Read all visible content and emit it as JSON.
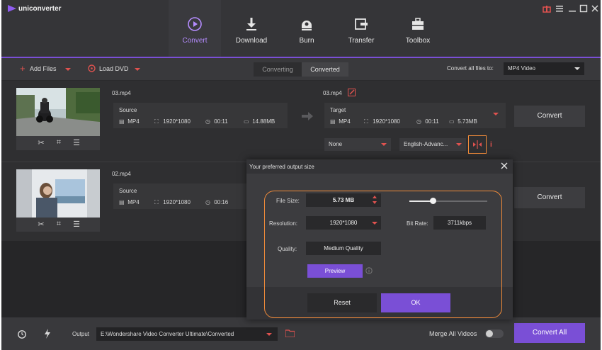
{
  "app": {
    "name": "uniconverter"
  },
  "nav": {
    "tabs": [
      {
        "label": "Convert",
        "icon": "convert-icon",
        "active": true
      },
      {
        "label": "Download",
        "icon": "download-icon"
      },
      {
        "label": "Burn",
        "icon": "burn-icon"
      },
      {
        "label": "Transfer",
        "icon": "transfer-icon"
      },
      {
        "label": "Toolbox",
        "icon": "toolbox-icon"
      }
    ]
  },
  "toolbar": {
    "add_files": "Add Files",
    "load_dvd": "Load DVD",
    "seg_converting": "Converting",
    "seg_converted": "Converted",
    "convert_all_label": "Convert all files to:",
    "convert_all_value": "MP4 Video"
  },
  "files": [
    {
      "name": "03.mp4",
      "source": {
        "title": "Source",
        "format": "MP4",
        "resolution": "1920*1080",
        "duration": "00:11",
        "size": "14.88MB"
      },
      "target": {
        "name": "03.mp4",
        "title": "Target",
        "format": "MP4",
        "resolution": "1920*1080",
        "duration": "00:11",
        "size": "5.73MB"
      },
      "subtitle": "None",
      "audio": "English-Advanc...",
      "convert": "Convert"
    },
    {
      "name": "02.mp4",
      "source": {
        "title": "Source",
        "format": "MP4",
        "resolution": "1920*1080",
        "duration": "00:16"
      },
      "convert": "Convert"
    }
  ],
  "dialog": {
    "title": "Your preferred output size",
    "file_size_label": "File Size:",
    "file_size_value": "5.73  MB",
    "slider_position": 0.3,
    "resolution_label": "Resolution:",
    "resolution_value": "1920*1080",
    "bitrate_label": "Bit Rate:",
    "bitrate_value": "3711kbps",
    "quality_label": "Quality:",
    "quality_value": "Medium Quality",
    "preview_label": "Preview",
    "reset_label": "Reset",
    "ok_label": "OK"
  },
  "bottom": {
    "output_label": "Output",
    "output_path": "E:\\Wondershare Video Converter Ultimate\\Converted",
    "merge_label": "Merge All Videos",
    "convert_all": "Convert All"
  },
  "colors": {
    "accent": "#7a4fd6",
    "highlight": "#f08b3a",
    "danger": "#e0524f"
  }
}
